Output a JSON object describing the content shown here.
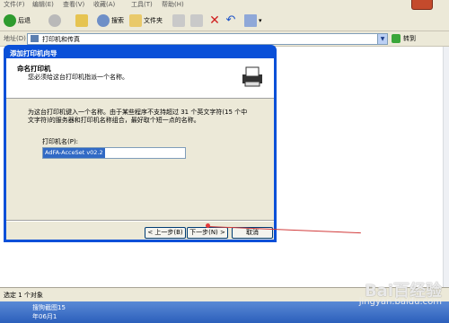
{
  "menubar": {
    "items": [
      "文件(F)",
      "编辑(E)",
      "查看(V)",
      "收藏(A)",
      "工具(T)",
      "帮助(H)"
    ]
  },
  "toolbar": {
    "back_label": "后退",
    "search_label": "搜索",
    "folders_label": "文件夹"
  },
  "address": {
    "label": "地址(D)",
    "value": "打印机和传真",
    "go_label": "转到"
  },
  "wizard": {
    "title": "添加打印机向导",
    "header_title": "命名打印机",
    "header_subtitle": "您必须给这台打印机指派一个名称。",
    "description": "为这台打印机键入一个名称。由于某些程序不支持超过 31 个英文字符(15 个中文字符)的服务器和打印机名称组合，最好取个短一点的名称。",
    "field_label": "打印机名(P):",
    "field_value": "AdFA-AcceSet v02.2",
    "back_button": "< 上一步(B)",
    "next_button": "下一步(N) >",
    "cancel_button": "取消"
  },
  "statusbar": {
    "text": "选定 1 个对象"
  },
  "taskbar": {
    "line1": "搜狗截图15",
    "line2": "年06月1"
  },
  "watermark": {
    "main": "Bai百经验",
    "sub": "jingyan.baidu.com"
  },
  "colors": {
    "title_blue": "#0a50d8",
    "window_bg": "#ece9d8",
    "annotation_red": "#d23a3a"
  }
}
